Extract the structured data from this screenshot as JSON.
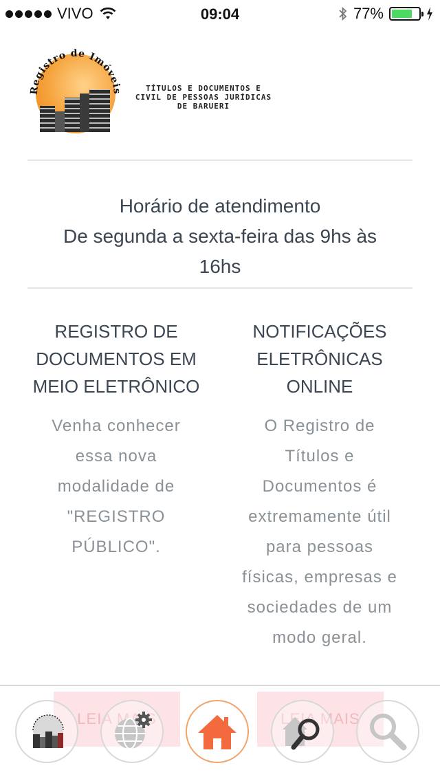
{
  "status_bar": {
    "carrier": "VIVO",
    "time": "09:04",
    "battery_percent": "77%",
    "battery_level": 0.77,
    "battery_color": "#4cd964"
  },
  "logo": {
    "arc_text": "Registro de Imóveis",
    "line1": "TÍTULOS E DOCUMENTOS E",
    "line2": "CIVIL DE PESSOAS JURÍDICAS",
    "line3": "DE BARUERI"
  },
  "hours": {
    "line1": "Horário de atendimento",
    "line2": "De segunda a sexta-feira das 9hs às",
    "line3": "16hs"
  },
  "features": [
    {
      "title_lines": [
        "REGISTRO DE",
        "DOCUMENTOS EM",
        "MEIO ELETRÔNICO"
      ],
      "desc_lines": [
        "Venha conhecer",
        "essa nova",
        "modalidade de",
        "\"REGISTRO",
        "PÚBLICO\"."
      ],
      "button": "LEIA MAIS"
    },
    {
      "title_lines": [
        "NOTIFICAÇÕES",
        "ELETRÔNICAS",
        "ONLINE"
      ],
      "desc_lines": [
        "O Registro de",
        "Títulos e",
        "Documentos é",
        "extremamente útil",
        "para pessoas",
        "físicas, empresas e",
        "sociedades de um",
        "modo geral."
      ],
      "button": "LEIA MAIS"
    }
  ],
  "tabbar": {
    "items": [
      {
        "icon": "registry-logo-icon"
      },
      {
        "icon": "globe-settings-icon"
      },
      {
        "icon": "home-icon",
        "active": true
      },
      {
        "icon": "property-search-icon"
      },
      {
        "icon": "search-icon"
      }
    ],
    "accent_color": "#f26a3e"
  }
}
